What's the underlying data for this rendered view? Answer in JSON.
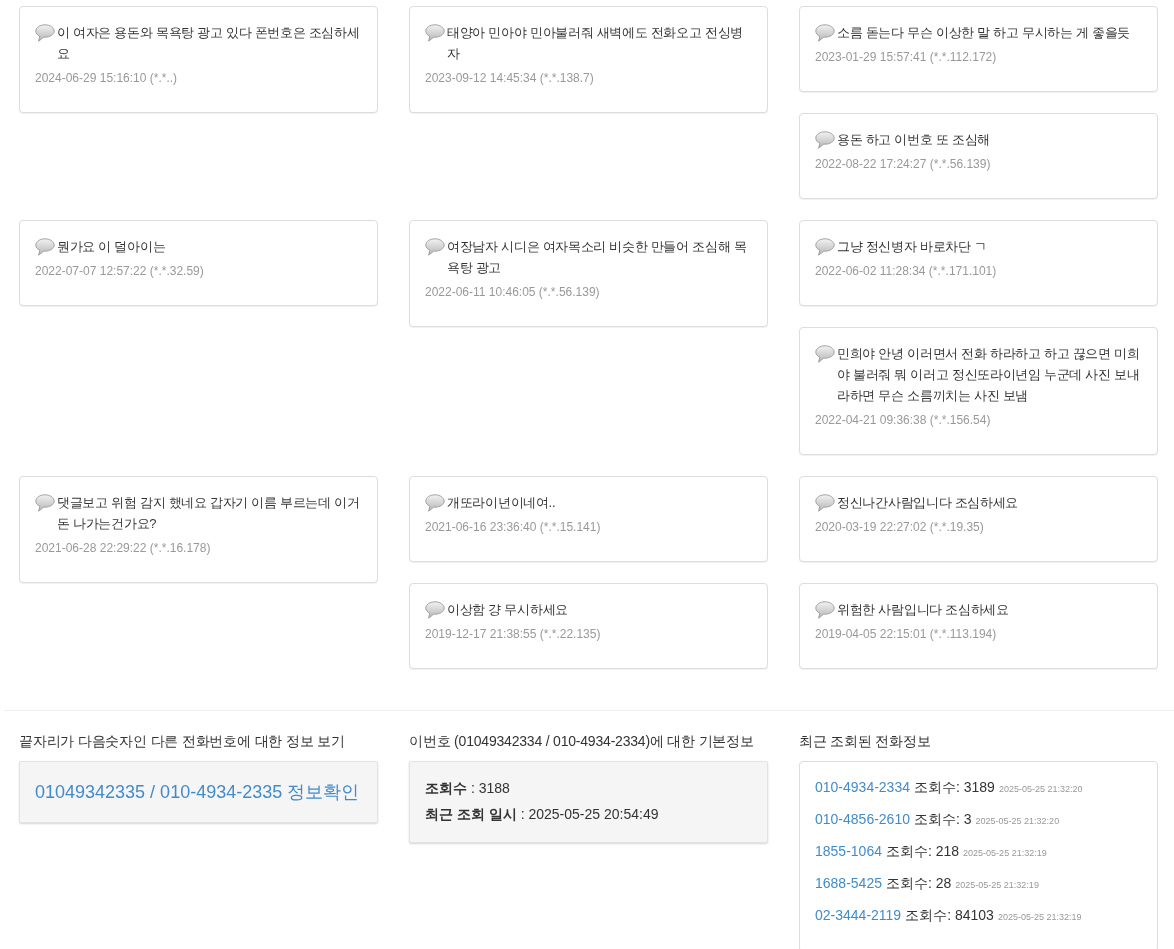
{
  "comment_rows": [
    {
      "columns": [
        {
          "comments": [
            {
              "text": "이 여자은 용돈와 목욕탕 광고 있다 폰번호은 조심하세요",
              "meta": "2024-06-29 15:16:10 (*.*..)"
            }
          ]
        },
        {
          "comments": [
            {
              "text": "태양아 민아야 민아불러줘 새벽에도 전화오고 전싱병자",
              "meta": "2023-09-12 14:45:34 (*.*.138.7)"
            }
          ]
        },
        {
          "comments": [
            {
              "text": "소름 돋는다 무슨 이상한 말 하고 무시하는 게 좋을듯",
              "meta": "2023-01-29 15:57:41 (*.*.112.172)"
            },
            {
              "text": "용돈 하고 이번호 또 조심해",
              "meta": "2022-08-22 17:24:27 (*.*.56.139)"
            }
          ]
        }
      ]
    },
    {
      "columns": [
        {
          "comments": [
            {
              "text": "뭔가요 이 덜아이는",
              "meta": "2022-07-07 12:57:22 (*.*.32.59)"
            }
          ]
        },
        {
          "comments": [
            {
              "text": "여장남자 시디은 여자목소리 비슷한 만들어 조심해 목욕탕 광고",
              "meta": "2022-06-11 10:46:05 (*.*.56.139)"
            }
          ]
        },
        {
          "comments": [
            {
              "text": "그냥 정신병자 바로차단 ㄱ",
              "meta": "2022-06-02 11:28:34 (*.*.171.101)"
            },
            {
              "text": "민희야 안녕 이러면서 전화 하라하고 하고 끊으면 미희야 불러줘 뭐 이러고 정신또라이년임 누군데 사진 보내라하면 무슨 소름끼치는 사진 보냄",
              "meta": "2022-04-21 09:36:38 (*.*.156.54)"
            }
          ]
        }
      ]
    },
    {
      "columns": [
        {
          "comments": [
            {
              "text": "댓글보고 위험 감지 했네요 갑자기 이름 부르는데 이거 돈 나가는건가요?",
              "meta": "2021-06-28 22:29:22 (*.*.16.178)"
            }
          ]
        },
        {
          "comments": [
            {
              "text": "개또라이년이네여..",
              "meta": "2021-06-16 23:36:40 (*.*.15.141)"
            },
            {
              "text": "이상함 걍 무시하세요",
              "meta": "2019-12-17 21:38:55 (*.*.22.135)"
            }
          ]
        },
        {
          "comments": [
            {
              "text": "정신나간사람입니다 조심하세요",
              "meta": "2020-03-19 22:27:02 (*.*.19.35)"
            },
            {
              "text": "위험한 사람입니다 조심하세요",
              "meta": "2019-04-05 22:15:01 (*.*.113.194)"
            }
          ]
        }
      ]
    }
  ],
  "next_number": {
    "heading": "끝자리가 다음숫자인 다른 전화번호에 대한 정보 보기",
    "link": "01049342335 / 010-4934-2335 정보확인"
  },
  "basic_info": {
    "heading": "이번호 (01049342334 / 010-4934-2334)에 대한 기본정보",
    "lines": [
      "**조회수** : 3188",
      "**최근 조회 일시** : 2025-05-25 20:54:49"
    ]
  },
  "recent": {
    "heading": "최근 조회된 전화정보",
    "items": [
      {
        "number": "010-4934-2334",
        "views": "조회수: 3189",
        "time": "2025-05-25 21:32:20"
      },
      {
        "number": "010-4856-2610",
        "views": "조회수: 3",
        "time": "2025-05-25 21:32:20"
      },
      {
        "number": "1855-1064",
        "views": "조회수: 218",
        "time": "2025-05-25 21:32:19"
      },
      {
        "number": "1688-5425",
        "views": "조회수: 28",
        "time": "2025-05-25 21:32:19"
      },
      {
        "number": "02-3444-2119",
        "views": "조회수: 84103",
        "time": "2025-05-25 21:32:19"
      }
    ]
  }
}
